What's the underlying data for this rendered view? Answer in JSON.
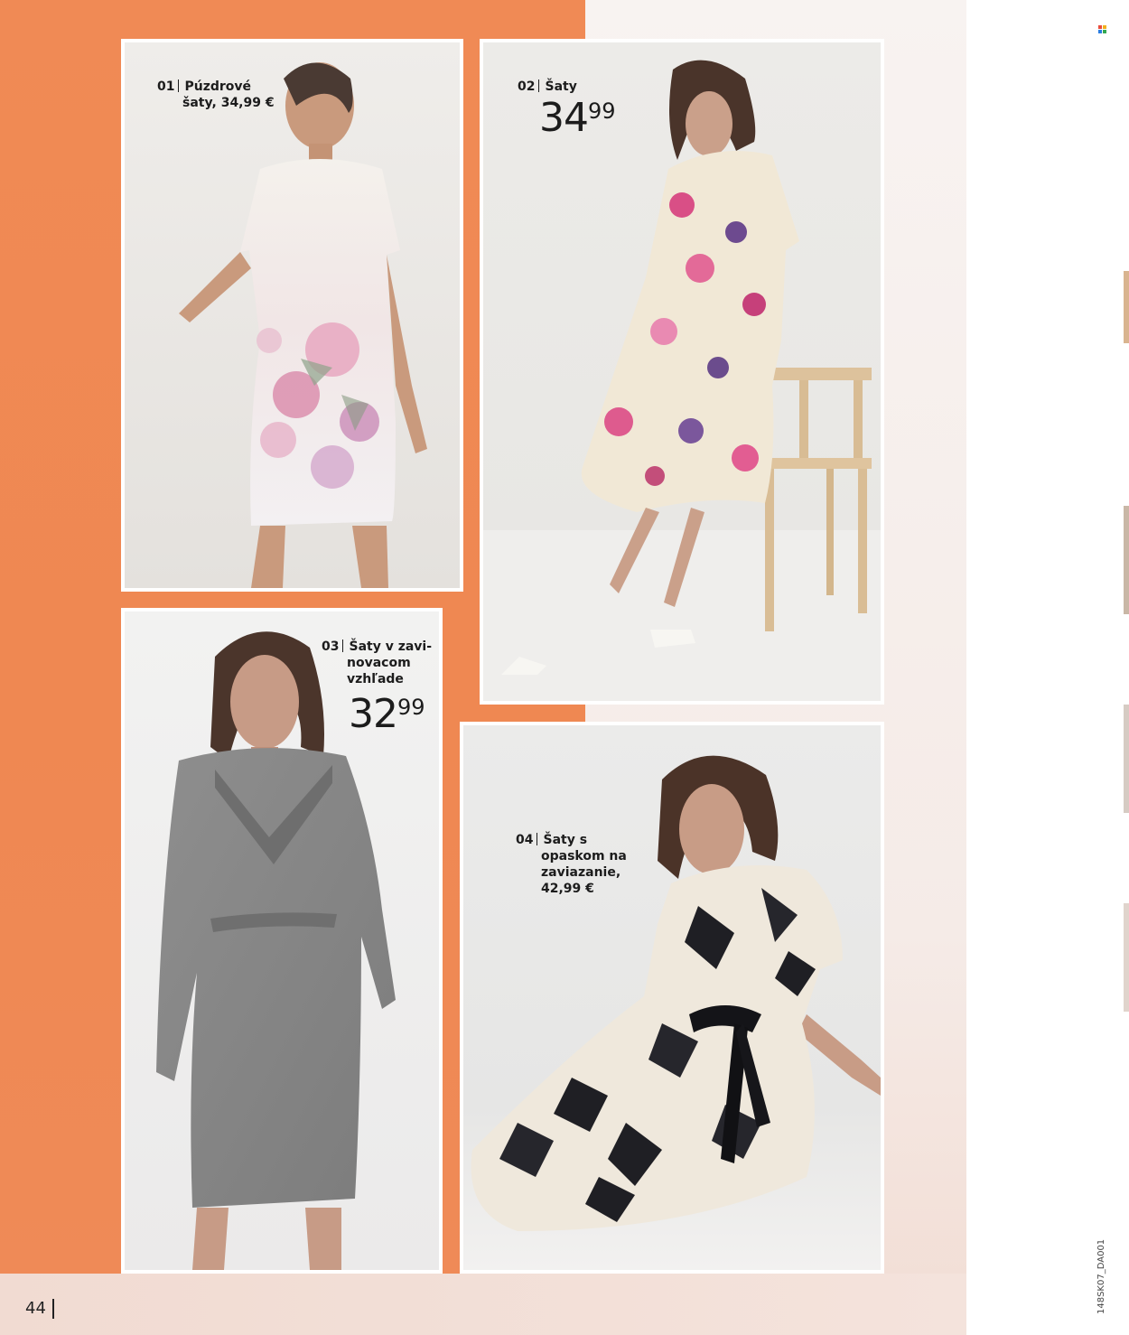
{
  "page": {
    "number": "44",
    "code": "148SK07_DA001"
  },
  "colors": {
    "orange": "#ef8852",
    "text": "#1c1c1c"
  },
  "products": [
    {
      "num": "01",
      "name_line1": "Púzdrové",
      "name_line2": "šaty, 34,99 €",
      "image": "woman-in-floral-white-shift-dress"
    },
    {
      "num": "02",
      "name_line1": "Šaty",
      "price_euros": "34",
      "price_cents": "99",
      "image": "woman-in-floral-tiered-dress-on-chair"
    },
    {
      "num": "03",
      "name_line1": "Šaty v zavi-",
      "name_line2": "novacom",
      "name_line3": "vzhľade",
      "price_euros": "32",
      "price_cents": "99",
      "image": "woman-in-grey-wrap-dress"
    },
    {
      "num": "04",
      "name_line1": "Šaty s",
      "name_line2": "opaskom na",
      "name_line3": "zaviazanie,",
      "name_line4": "42,99 €",
      "image": "woman-in-black-white-floral-belted-dress"
    }
  ]
}
